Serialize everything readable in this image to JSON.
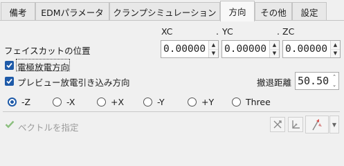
{
  "tabs": [
    {
      "label": "備考"
    },
    {
      "label": "EDMパラメータ"
    },
    {
      "label": "クランプシミュレーション"
    },
    {
      "label": "方向"
    },
    {
      "label": "その他"
    },
    {
      "label": "設定"
    }
  ],
  "active_tab": "方向",
  "position": {
    "label": "フェイスカットの位置",
    "headers": {
      "xc": "XC",
      "yc": "YC",
      "zc": "ZC",
      "dot": "."
    },
    "xc_value": "0.00000",
    "yc_value": "0.00000",
    "zc_value": "0.00000"
  },
  "options": {
    "electrode_direction_label": "電極放電方向",
    "electrode_direction_checked": true,
    "preview_label": "プレビュー放電引き込み方向",
    "preview_checked": true,
    "retract_label": "撤退距離",
    "retract_value": "50.50"
  },
  "directions": [
    {
      "label": "-Z",
      "selected": true
    },
    {
      "label": "-X",
      "selected": false
    },
    {
      "label": "+X",
      "selected": false
    },
    {
      "label": "-Y",
      "selected": false
    },
    {
      "label": "+Y",
      "selected": false
    },
    {
      "label": "Three",
      "selected": false
    }
  ],
  "vector": {
    "label": "ベクトルを指定"
  },
  "colors": {
    "accent": "#1e5aa8",
    "check_disabled": "#8bbf7e",
    "icon_red": "#d9534f"
  }
}
